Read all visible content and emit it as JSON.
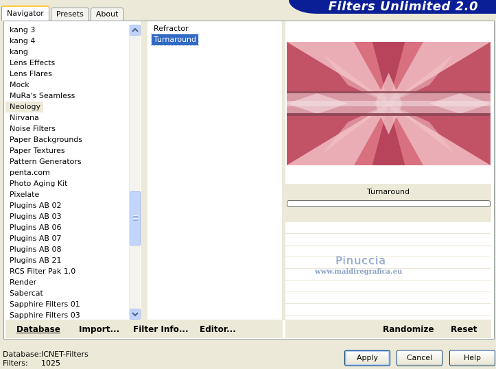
{
  "tabs": [
    {
      "label": "Navigator",
      "active": true
    },
    {
      "label": "Presets",
      "active": false
    },
    {
      "label": "About",
      "active": false
    }
  ],
  "banner": {
    "title": "Filters Unlimited 2.0",
    "color": "#0a1e96"
  },
  "categories": {
    "items": [
      "kang 3",
      "kang 4",
      "kang",
      "Lens Effects",
      "Lens Flares",
      "Mock",
      "MuRa's Seamless",
      "Neology",
      "Nirvana",
      "Noise Filters",
      "Paper Backgrounds",
      "Paper Textures",
      "Pattern Generators",
      "penta.com",
      "Photo Aging Kit",
      "Pixelate",
      "Plugins AB 02",
      "Plugins AB 03",
      "Plugins AB 06",
      "Plugins AB 07",
      "Plugins AB 08",
      "Plugins AB 21",
      "RCS Filter Pak 1.0",
      "Render",
      "Sabercat",
      "Sapphire Filters 01",
      "Sapphire Filters 03"
    ],
    "selected": "Neology"
  },
  "filters": {
    "items": [
      "Refractor",
      "Turnaround"
    ],
    "selected": "Turnaround"
  },
  "preview": {
    "caption": "Turnaround",
    "colors": {
      "dark": "#b03a52",
      "mid": "#d8707f",
      "light": "#f4c7cc"
    },
    "progress": 0
  },
  "watermark": {
    "name": "Pinuccia",
    "url": "www.maidiregrafica.eu"
  },
  "toolbar_left": {
    "database": "Database",
    "import": "Import...",
    "filter_info": "Filter Info...",
    "editor": "Editor..."
  },
  "toolbar_right": {
    "randomize": "Randomize",
    "reset": "Reset"
  },
  "status": {
    "database_label": "Database:",
    "database_value": "ICNET-Filters",
    "filters_label": "Filters:",
    "filters_value": "1025"
  },
  "buttons": {
    "apply": "Apply",
    "cancel": "Cancel",
    "help": "Help"
  }
}
